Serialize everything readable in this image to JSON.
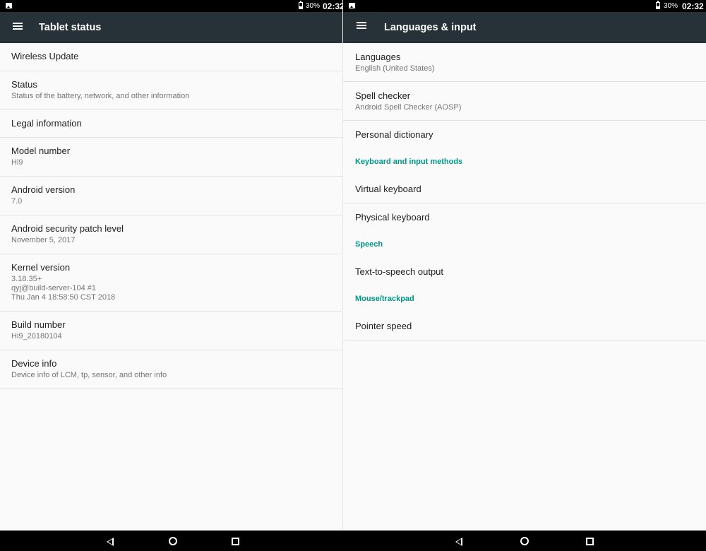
{
  "status_bar": {
    "battery": "30%",
    "time": "02:32"
  },
  "left": {
    "title": "Tablet status",
    "items": [
      {
        "title": "Wireless Update",
        "sub": ""
      },
      {
        "title": "Status",
        "sub": "Status of the battery, network, and other information"
      },
      {
        "title": "Legal information",
        "sub": ""
      },
      {
        "title": "Model number",
        "sub": "Hi9"
      },
      {
        "title": "Android version",
        "sub": "7.0"
      },
      {
        "title": "Android security patch level",
        "sub": "November 5, 2017"
      },
      {
        "title": "Kernel version",
        "sub": "3.18.35+\nqyj@build-server-104 #1\nThu Jan 4 18:58:50 CST 2018"
      },
      {
        "title": "Build number",
        "sub": "Hi9_20180104"
      },
      {
        "title": "Device info",
        "sub": "Device info of LCM, tp, sensor, and other info"
      }
    ]
  },
  "right": {
    "title": "Languages & input",
    "items": [
      {
        "title": "Languages",
        "sub": "English (United States)"
      },
      {
        "title": "Spell checker",
        "sub": "Android Spell Checker (AOSP)"
      },
      {
        "title": "Personal dictionary",
        "sub": ""
      }
    ],
    "keyboard_category": "Keyboard and input methods",
    "keyboard_items": [
      {
        "title": "Virtual keyboard"
      },
      {
        "title": "Physical keyboard"
      }
    ],
    "speech_category": "Speech",
    "speech_items": [
      {
        "title": "Text-to-speech output"
      }
    ],
    "mouse_category": "Mouse/trackpad",
    "mouse_items": [
      {
        "title": "Pointer speed"
      }
    ]
  },
  "icons": {
    "menu": "hamburger-menu-icon",
    "notification": "image-notification-icon",
    "battery": "battery-icon",
    "back": "back-triangle-icon",
    "home": "home-circle-icon",
    "recents": "recents-square-icon"
  },
  "colors": {
    "appbar": "#263238",
    "accent": "#009688",
    "background": "#fafafa"
  }
}
